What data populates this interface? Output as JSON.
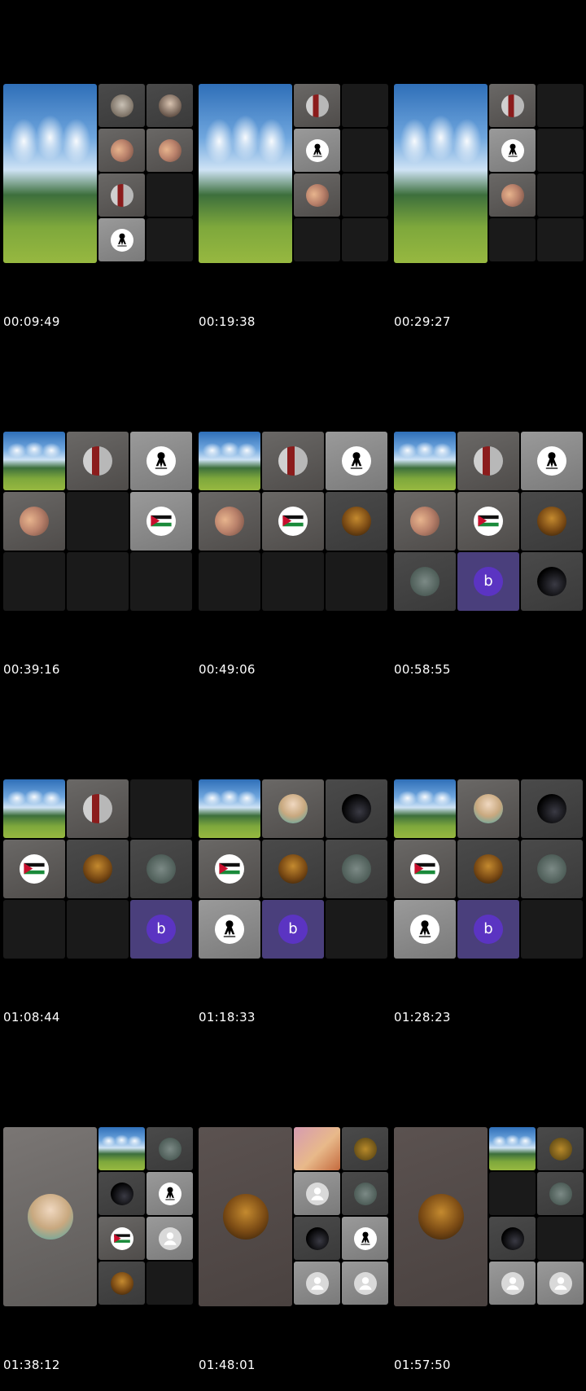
{
  "frames": [
    {
      "timestamp": "00:09:49"
    },
    {
      "timestamp": "00:19:38"
    },
    {
      "timestamp": "00:29:27"
    },
    {
      "timestamp": "00:39:16"
    },
    {
      "timestamp": "00:49:06"
    },
    {
      "timestamp": "00:58:55"
    },
    {
      "timestamp": "01:08:44"
    },
    {
      "timestamp": "01:18:33"
    },
    {
      "timestamp": "01:28:23"
    },
    {
      "timestamp": "01:38:12"
    },
    {
      "timestamp": "01:48:01"
    },
    {
      "timestamp": "01:57:50"
    }
  ],
  "avatar_letter": "b",
  "colors": {
    "background": "#000000",
    "empty_tile": "#1a1a1a",
    "accent_purple": "#5b34c2"
  }
}
